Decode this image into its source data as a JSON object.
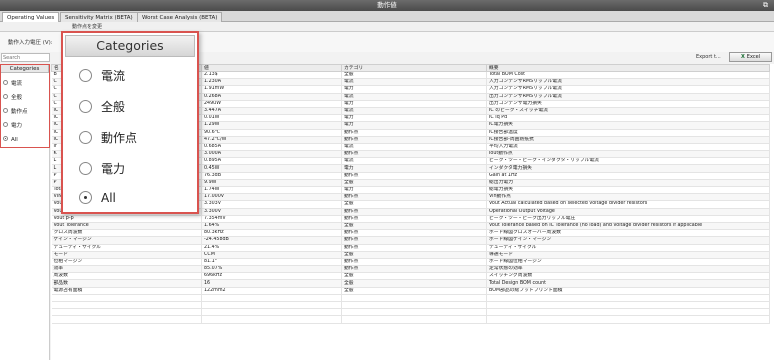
{
  "window": {
    "title": "動作値",
    "restore_glyph": "⧉"
  },
  "tabs": [
    {
      "label": "Operating Values",
      "active": true
    },
    {
      "label": "Sensitivity Matrix (BETA)",
      "active": false
    },
    {
      "label": "Worst Case Analysis (BETA)",
      "active": false
    }
  ],
  "toolbar": {
    "change_op_label": "動作点を変更",
    "input_voltage_label": "動作入力電圧 (V):",
    "search_placeholder": "Search",
    "export_label": "Export t...",
    "excel_label": "Excel"
  },
  "sidebar": {
    "title": "Categories",
    "items": [
      {
        "label": "電流",
        "selected": false
      },
      {
        "label": "全般",
        "selected": false
      },
      {
        "label": "動作点",
        "selected": false
      },
      {
        "label": "電力",
        "selected": false
      },
      {
        "label": "All",
        "selected": true
      }
    ]
  },
  "popup": {
    "title": "Categories",
    "items": [
      {
        "label": "電流",
        "selected": false
      },
      {
        "label": "全般",
        "selected": false
      },
      {
        "label": "動作点",
        "selected": false
      },
      {
        "label": "電力",
        "selected": false
      },
      {
        "label": "All",
        "selected": true
      }
    ]
  },
  "table": {
    "headers": [
      "名",
      "値",
      "カテゴリ",
      "概要"
    ],
    "rows": [
      [
        "B",
        "2.13$",
        "全般",
        "Total BOM Cost"
      ],
      [
        "C",
        "1.230A",
        "電流",
        "入力コンデンサRMSリップル電流"
      ],
      [
        "C",
        "1.91mW",
        "電力",
        "入力コンデンサRMSリップル電流"
      ],
      [
        "C",
        "0.268A",
        "電流",
        "出力コンデンサRMSリップル電流"
      ],
      [
        "C",
        "249uW",
        "電力",
        "出力コンデンサ電力損失"
      ],
      [
        "IC",
        "3.447A",
        "電流",
        "IC のピーク・スイッチ電流"
      ],
      [
        "IC",
        "0.01W",
        "電力",
        "IC Iq Pd"
      ],
      [
        "IC",
        "1.29W",
        "電力",
        "IC電力損失"
      ],
      [
        "IC",
        "90.6℃",
        "動作点",
        "IC接合部温度"
      ],
      [
        "IC",
        "47.2℃/W",
        "動作点",
        "IC接合部-周囲熱抵抗"
      ],
      [
        "Ir",
        "0.685A",
        "電流",
        "平均入力電流"
      ],
      [
        "K",
        "3.000A",
        "動作点",
        "Iout動作点"
      ],
      [
        "L",
        "0.895A",
        "電流",
        "ピーク・ツー・ピーク・インダクタ・リップル電流"
      ],
      [
        "L",
        "0.45W",
        "電力",
        "インダクタ電力損失"
      ],
      [
        "P",
        "76.3dB",
        "動作点",
        "Gain at 1Hz"
      ],
      [
        "P",
        "9.9W",
        "全般",
        "総出力電力"
      ],
      [
        "Total Pd",
        "1.74W",
        "電力",
        "総電力損失"
      ],
      [
        "VIN_OP",
        "17.000V",
        "動作点",
        "Vin動作点"
      ],
      [
        "Vout Actual",
        "3.303V",
        "全般",
        "Vout Actual calculated based on selected voltage divider resistors"
      ],
      [
        "Vout OP",
        "3.300V",
        "動作点",
        "Operational Output Voltage"
      ],
      [
        "Vout p-p",
        "7.354mV",
        "動作点",
        "ピーク・ツー・ピーク出力リップル電圧"
      ],
      [
        "Vout Tolerance",
        "1.64%",
        "全般",
        "Vout Tolerance based on IC Tolerance (no load) and voltage divider resistors if applicable"
      ],
      [
        "クロス周波数",
        "80.3kHz",
        "動作点",
        "ボード線図クロスオーバー周波数"
      ],
      [
        "ゲイン・マージン",
        "-24.458dB",
        "動作点",
        "ボード線図ゲイン・マージン"
      ],
      [
        "デューティ・サイクル",
        "21.4%",
        "動作点",
        "デューティ・サイクル"
      ],
      [
        "モード",
        "CCM",
        "全般",
        "導通モード"
      ],
      [
        "位相マージン",
        "81.1°",
        "動作点",
        "ボード線図位相マージン"
      ],
      [
        "効率",
        "85.07%",
        "動作点",
        "定常状態の効率"
      ],
      [
        "周波数",
        "696kHz",
        "全般",
        "スイッチング周波数"
      ],
      [
        "部品数",
        "16",
        "全般",
        "Total Design BOM count"
      ],
      [
        "電源占有面積",
        "122mm2",
        "全般",
        "BOM部品の総フットプリント面積"
      ]
    ]
  },
  "colors": {
    "highlight_border": "#d9534f",
    "excel_icon": "#1d6f35",
    "apply_button": "#3a9a3a"
  }
}
